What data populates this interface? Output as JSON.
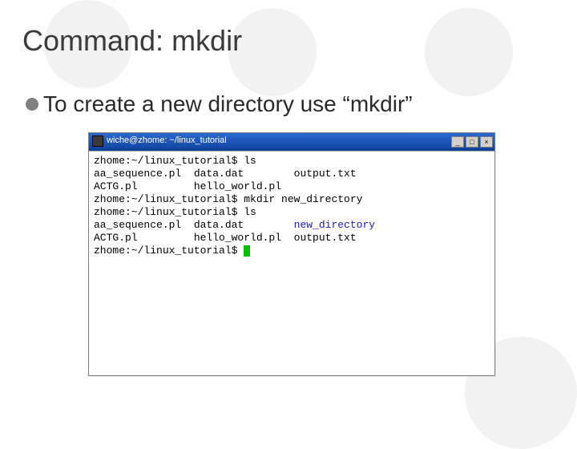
{
  "slide": {
    "title": "Command: mkdir",
    "bullet": "To create a new directory use “mkdir”"
  },
  "window": {
    "title": "wiche@zhome: ~/linux_tutorial",
    "buttons": {
      "min": "_",
      "max": "□",
      "close": "×"
    }
  },
  "terminal": {
    "lines": [
      "zhome:~/linux_tutorial$ ls",
      "aa_sequence.pl  data.dat        output.txt",
      "ACTG.pl         hello_world.pl",
      "zhome:~/linux_tutorial$ mkdir new_directory",
      "zhome:~/linux_tutorial$ ls",
      "aa_sequence.pl  data.dat        ",
      "ACTG.pl         hello_world.pl  output.txt",
      "zhome:~/linux_tutorial$ "
    ],
    "new_dir_label": "new_directory"
  }
}
